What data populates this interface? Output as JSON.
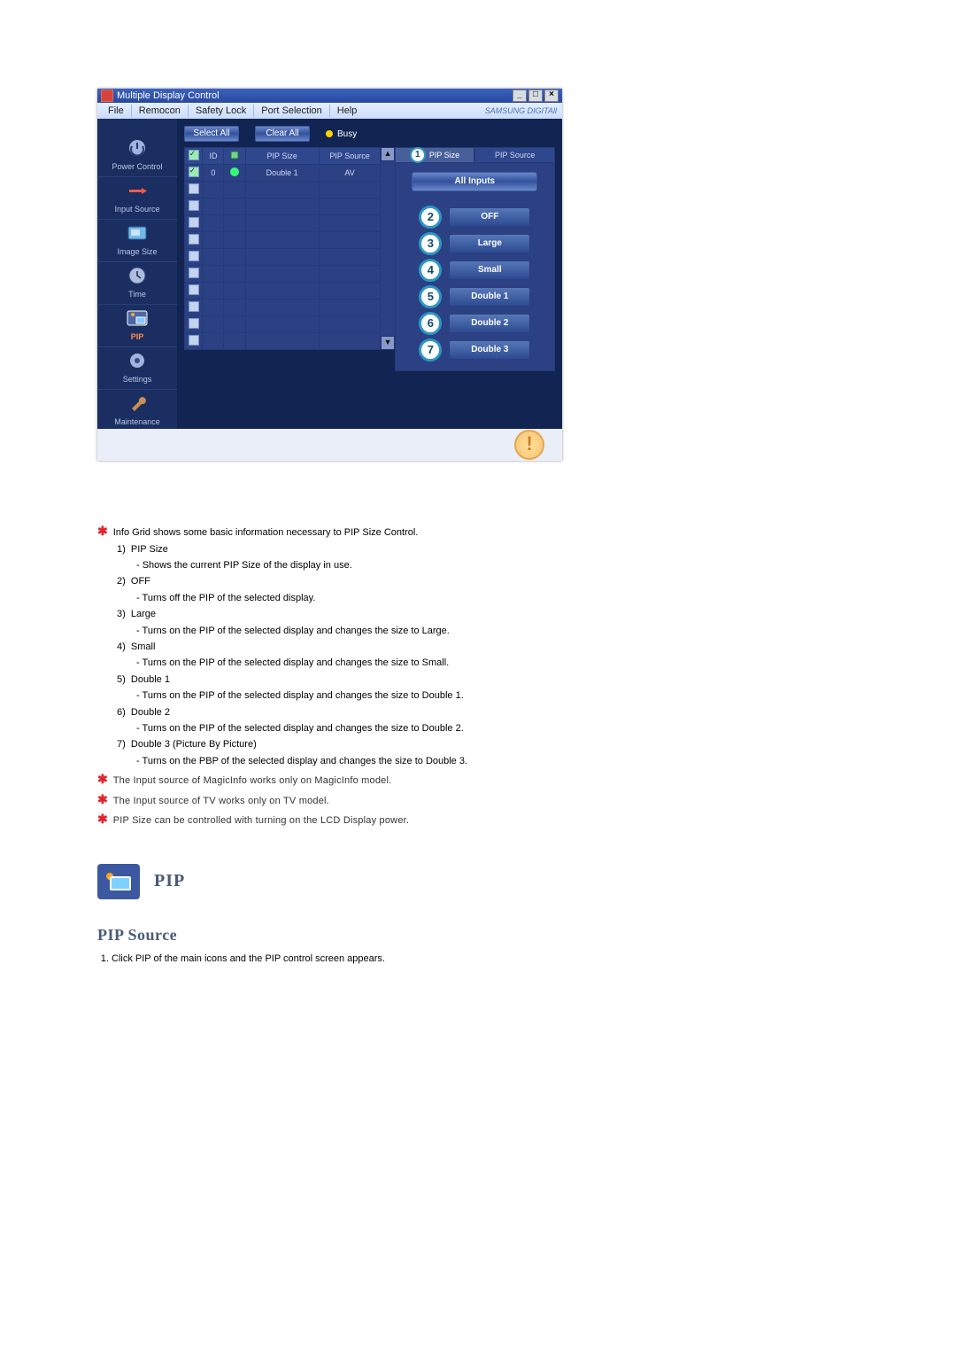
{
  "window": {
    "title": "Multiple Display Control",
    "menus": [
      "File",
      "Remocon",
      "Safety Lock",
      "Port Selection",
      "Help"
    ],
    "brand": "SAMSUNG DIGITAll"
  },
  "sidebar": {
    "items": [
      {
        "label": "Power Control"
      },
      {
        "label": "Input Source"
      },
      {
        "label": "Image Size"
      },
      {
        "label": "Time"
      },
      {
        "label": "PIP"
      },
      {
        "label": "Settings"
      },
      {
        "label": "Maintenance"
      }
    ]
  },
  "toolbar": {
    "select_all": "Select All",
    "clear_all": "Clear All",
    "busy": "Busy"
  },
  "table": {
    "headers": {
      "id": "ID",
      "pip_size": "PIP Size",
      "pip_source": "PIP Source"
    },
    "rows": [
      {
        "checked": true,
        "id": "0",
        "status": "green",
        "pip_size": "Double 1",
        "pip_source": "AV"
      },
      {
        "checked": false
      },
      {
        "checked": false
      },
      {
        "checked": false
      },
      {
        "checked": false
      },
      {
        "checked": false
      },
      {
        "checked": false
      },
      {
        "checked": false
      },
      {
        "checked": false
      },
      {
        "checked": false
      },
      {
        "checked": false
      }
    ]
  },
  "panel": {
    "tab_active": "PIP Size",
    "tab_inactive": "PIP Source",
    "all_inputs": "All Inputs",
    "callout_1": "1",
    "options": [
      {
        "num": "2",
        "label": "OFF"
      },
      {
        "num": "3",
        "label": "Large"
      },
      {
        "num": "4",
        "label": "Small"
      },
      {
        "num": "5",
        "label": "Double 1"
      },
      {
        "num": "6",
        "label": "Double 2"
      },
      {
        "num": "7",
        "label": "Double 3"
      }
    ]
  },
  "doc": {
    "intro": "Info Grid shows some basic information necessary to PIP Size Control.",
    "items": [
      {
        "num": "1)",
        "title": "PIP Size",
        "desc": "- Shows the current PIP Size of the display in use."
      },
      {
        "num": "2)",
        "title": "OFF",
        "desc": "- Turns off the PIP of the selected display."
      },
      {
        "num": "3)",
        "title": "Large",
        "desc": "- Turns on the PIP of the selected display and changes the size to Large."
      },
      {
        "num": "4)",
        "title": "Small",
        "desc": "- Turns on the PIP of the selected display and changes the size to Small."
      },
      {
        "num": "5)",
        "title": "Double 1",
        "desc": "- Turns on the PIP of the selected display and changes the size to Double 1."
      },
      {
        "num": "6)",
        "title": "Double 2",
        "desc": "- Turns on the PIP of the selected display and changes the size to Double 2."
      },
      {
        "num": "7)",
        "title": "Double 3 (Picture By Picture)",
        "desc": "- Turns on the PBP of the selected display and changes the size to Double 3."
      }
    ],
    "notes": [
      "The Input source of MagicInfo works only on MagicInfo model.",
      "The Input source of TV works only on TV model.",
      "PIP Size can be controlled with turning on the LCD Display power."
    ],
    "sec_title": "PIP",
    "sub_title": "PIP Source",
    "step_1": "Click PIP of the main icons and the PIP control screen appears."
  }
}
